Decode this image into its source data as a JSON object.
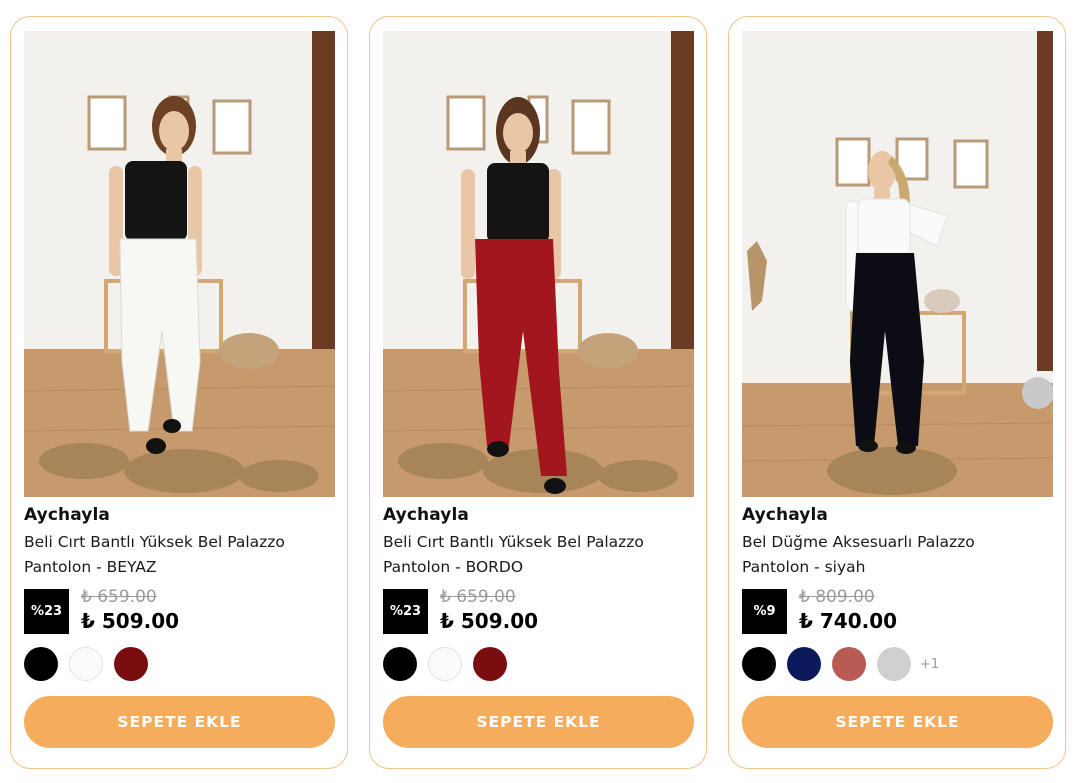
{
  "currency_symbol": "₺",
  "accent_color": "#f5ad5d",
  "products": [
    {
      "brand": "Aychayla",
      "name": "Beli Cırt Bantlı Yüksek Bel Palazzo Pantolon - BEYAZ",
      "discount": "%23",
      "old_price": "₺ 659.00",
      "price": "₺ 509.00",
      "swatches": [
        {
          "color": "#000000",
          "name": "black"
        },
        {
          "color": "#fbfbfb",
          "name": "white"
        },
        {
          "color": "#7a0d0f",
          "name": "maroon"
        }
      ],
      "more_colors": "",
      "cart_label": "SEPETE EKLE",
      "image_alt": "model-white-pants"
    },
    {
      "brand": "Aychayla",
      "name": "Beli Cırt Bantlı Yüksek Bel Palazzo Pantolon - BORDO",
      "discount": "%23",
      "old_price": "₺ 659.00",
      "price": "₺ 509.00",
      "swatches": [
        {
          "color": "#000000",
          "name": "black"
        },
        {
          "color": "#fbfbfb",
          "name": "white"
        },
        {
          "color": "#7a0d0f",
          "name": "maroon"
        }
      ],
      "more_colors": "",
      "cart_label": "SEPETE EKLE",
      "image_alt": "model-red-pants"
    },
    {
      "brand": "Aychayla",
      "name": "Bel Düğme Aksesuarlı Palazzo Pantolon - siyah",
      "discount": "%9",
      "old_price": "₺ 809.00",
      "price": "₺ 740.00",
      "swatches": [
        {
          "color": "#000000",
          "name": "black"
        },
        {
          "color": "#0c1a5c",
          "name": "navy"
        },
        {
          "color": "#b95a55",
          "name": "rose"
        },
        {
          "color": "#d0d0d0",
          "name": "grey"
        }
      ],
      "more_colors": "+1",
      "cart_label": "SEPETE EKLE",
      "image_alt": "model-black-pants"
    }
  ]
}
